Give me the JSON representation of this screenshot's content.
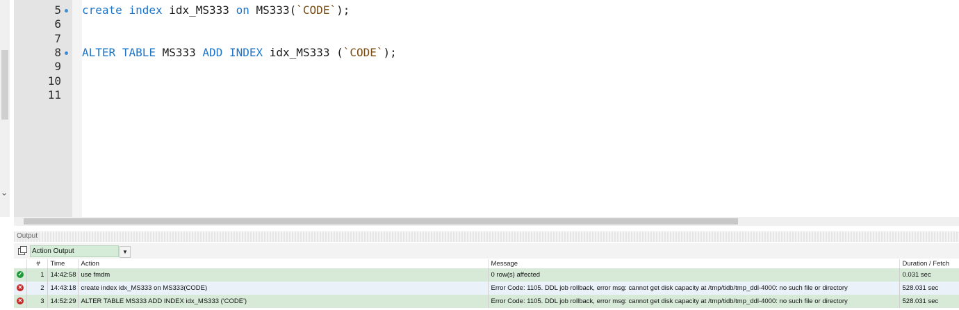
{
  "editor": {
    "lines": [
      {
        "num": "5",
        "marker": true,
        "tokens": [
          {
            "text": "create",
            "kind": "kw"
          },
          {
            "text": " "
          },
          {
            "text": "index",
            "kind": "kw"
          },
          {
            "text": " idx_MS333 "
          },
          {
            "text": "on",
            "kind": "kw"
          },
          {
            "text": " MS333("
          },
          {
            "text": "`CODE`",
            "kind": "str"
          },
          {
            "text": ");"
          }
        ]
      },
      {
        "num": "6",
        "marker": false,
        "tokens": []
      },
      {
        "num": "7",
        "marker": false,
        "tokens": []
      },
      {
        "num": "8",
        "marker": true,
        "tokens": [
          {
            "text": "ALTER",
            "kind": "kw"
          },
          {
            "text": " "
          },
          {
            "text": "TABLE",
            "kind": "kw"
          },
          {
            "text": " MS333 "
          },
          {
            "text": "ADD",
            "kind": "kw"
          },
          {
            "text": " "
          },
          {
            "text": "INDEX",
            "kind": "kw"
          },
          {
            "text": " idx_MS333 ("
          },
          {
            "text": "`CODE`",
            "kind": "str"
          },
          {
            "text": ");"
          }
        ]
      },
      {
        "num": "9",
        "marker": false,
        "tokens": []
      },
      {
        "num": "10",
        "marker": false,
        "tokens": []
      },
      {
        "num": "11",
        "marker": false,
        "tokens": []
      }
    ]
  },
  "output": {
    "title": "Output",
    "selected_view": "Action Output",
    "columns": [
      "",
      "#",
      "Time",
      "Action",
      "Message",
      "Duration / Fetch"
    ],
    "rows": [
      {
        "status": "success",
        "num": "1",
        "time": "14:42:58",
        "action": "use fmdm",
        "message": "0 row(s) affected",
        "duration": "0.031 sec"
      },
      {
        "status": "error",
        "num": "2",
        "time": "14:43:18",
        "action": "create index idx_MS333 on MS333(CODE)",
        "message": "Error Code: 1105. DDL job rollback, error msg: cannot get disk capacity at /tmp/tidb/tmp_ddl-4000: no such file or directory",
        "duration": "528.031 sec"
      },
      {
        "status": "error",
        "num": "3",
        "time": "14:52:29",
        "action": "ALTER TABLE MS333 ADD INDEX idx_MS333 ('CODE')",
        "message": "Error Code: 1105. DDL job rollback, error msg: cannot get disk capacity at /tmp/tidb/tmp_ddl-4000: no such file or directory",
        "duration": "528.031 sec"
      }
    ]
  },
  "colors": {
    "keyword": "#1c74c8",
    "string": "#7a4a12",
    "success_row": "#d7ead8",
    "alt_row": "#eaf1f8"
  },
  "icons": {
    "success": "check-circle-icon",
    "error": "x-circle-icon",
    "copy": "copy-icon",
    "dropdown": "chevron-down-icon"
  }
}
